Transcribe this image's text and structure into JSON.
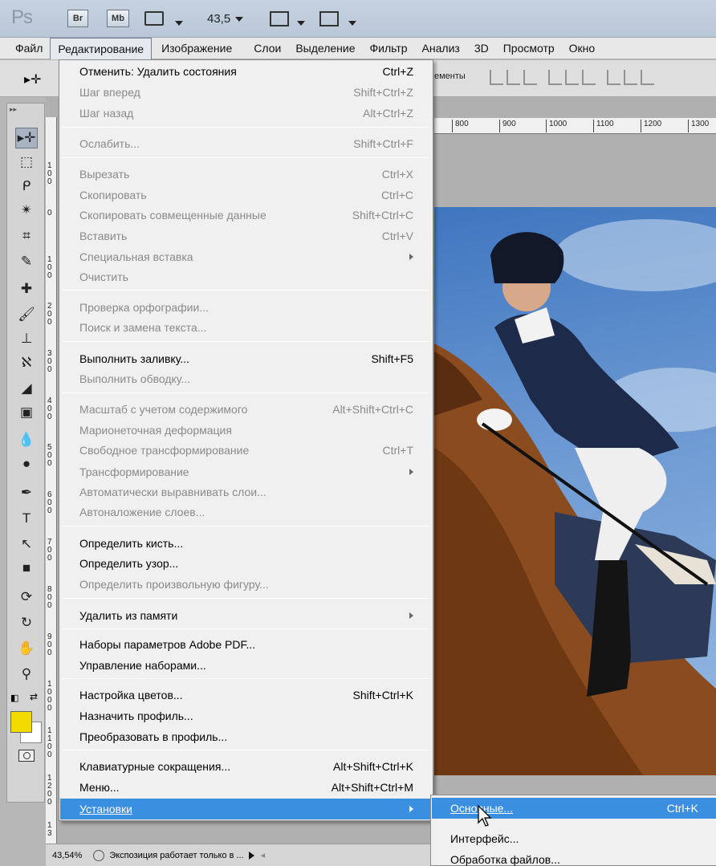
{
  "app": {
    "logo": "Ps",
    "bridge_btn": "Br",
    "minibridge_btn": "Mb",
    "zoom_value": "43,5"
  },
  "menubar": {
    "items": [
      "Файл",
      "Редактирование",
      "Изображение",
      "Слои",
      "Выделение",
      "Фильтр",
      "Анализ",
      "3D",
      "Просмотр",
      "Окно"
    ],
    "active": "Редактирование"
  },
  "optbar": {
    "fragment": "ементы"
  },
  "ruler": {
    "h_labels": [
      "800",
      "900",
      "1000",
      "1100",
      "1200",
      "1300"
    ],
    "v_labels": [
      "1 0 0",
      "0",
      "1 0 0",
      "2 0 0",
      "3 0 0",
      "4 0 0",
      "5 0 0",
      "6 0 0",
      "7 0 0",
      "8 0 0",
      "9 0 0",
      "1 0 0 0",
      "1 1 0 0",
      "1 2 0 0",
      "1 3"
    ]
  },
  "edit_menu": {
    "items": [
      {
        "label": "Отменить: Удалить состояния",
        "shortcut": "Ctrl+Z",
        "enabled": true
      },
      {
        "label": "Шаг вперед",
        "shortcut": "Shift+Ctrl+Z",
        "enabled": false
      },
      {
        "label": "Шаг назад",
        "shortcut": "Alt+Ctrl+Z",
        "enabled": false
      },
      {
        "label": "Ослабить...",
        "shortcut": "Shift+Ctrl+F",
        "enabled": false
      },
      {
        "label": "Вырезать",
        "shortcut": "Ctrl+X",
        "enabled": false
      },
      {
        "label": "Скопировать",
        "shortcut": "Ctrl+C",
        "enabled": false
      },
      {
        "label": "Скопировать совмещенные данные",
        "shortcut": "Shift+Ctrl+C",
        "enabled": false
      },
      {
        "label": "Вставить",
        "shortcut": "Ctrl+V",
        "enabled": false
      },
      {
        "label": "Специальная вставка",
        "shortcut": "",
        "enabled": false,
        "submenu": true
      },
      {
        "label": "Очистить",
        "shortcut": "",
        "enabled": false
      },
      {
        "label": "Проверка орфографии...",
        "shortcut": "",
        "enabled": false
      },
      {
        "label": "Поиск и замена текста...",
        "shortcut": "",
        "enabled": false
      },
      {
        "label": "Выполнить заливку...",
        "shortcut": "Shift+F5",
        "enabled": true
      },
      {
        "label": "Выполнить обводку...",
        "shortcut": "",
        "enabled": false
      },
      {
        "label": "Масштаб с учетом содержимого",
        "shortcut": "Alt+Shift+Ctrl+C",
        "enabled": false
      },
      {
        "label": "Марионеточная деформация",
        "shortcut": "",
        "enabled": false
      },
      {
        "label": "Свободное трансформирование",
        "shortcut": "Ctrl+T",
        "enabled": false
      },
      {
        "label": "Трансформирование",
        "shortcut": "",
        "enabled": false,
        "submenu": true
      },
      {
        "label": "Автоматически выравнивать слои...",
        "shortcut": "",
        "enabled": false
      },
      {
        "label": "Автоналожение слоев...",
        "shortcut": "",
        "enabled": false
      },
      {
        "label": "Определить кисть...",
        "shortcut": "",
        "enabled": true
      },
      {
        "label": "Определить узор...",
        "shortcut": "",
        "enabled": true
      },
      {
        "label": "Определить произвольную фигуру...",
        "shortcut": "",
        "enabled": false
      },
      {
        "label": "Удалить из памяти",
        "shortcut": "",
        "enabled": true,
        "submenu": true
      },
      {
        "label": "Наборы параметров Adobe PDF...",
        "shortcut": "",
        "enabled": true
      },
      {
        "label": "Управление наборами...",
        "shortcut": "",
        "enabled": true
      },
      {
        "label": "Настройка цветов...",
        "shortcut": "Shift+Ctrl+K",
        "enabled": true
      },
      {
        "label": "Назначить профиль...",
        "shortcut": "",
        "enabled": true
      },
      {
        "label": "Преобразовать в профиль...",
        "shortcut": "",
        "enabled": true
      },
      {
        "label": "Клавиатурные сокращения...",
        "shortcut": "Alt+Shift+Ctrl+K",
        "enabled": true
      },
      {
        "label": "Меню...",
        "shortcut": "Alt+Shift+Ctrl+M",
        "enabled": true
      },
      {
        "label": "Установки",
        "shortcut": "",
        "enabled": true,
        "submenu": true,
        "highlighted": true
      }
    ]
  },
  "prefs_submenu": {
    "items": [
      {
        "label": "Основные...",
        "shortcut": "Ctrl+K",
        "highlighted": true
      },
      {
        "label": "Интерфейс...",
        "shortcut": ""
      },
      {
        "label": "Обработка файлов...",
        "shortcut": ""
      }
    ]
  },
  "status": {
    "zoom": "43,54%",
    "info": "Экспозиция работает только в ..."
  },
  "colors": {
    "foreground": "#f2dc00",
    "background": "#ffffff",
    "highlight": "#3b8fe0"
  }
}
